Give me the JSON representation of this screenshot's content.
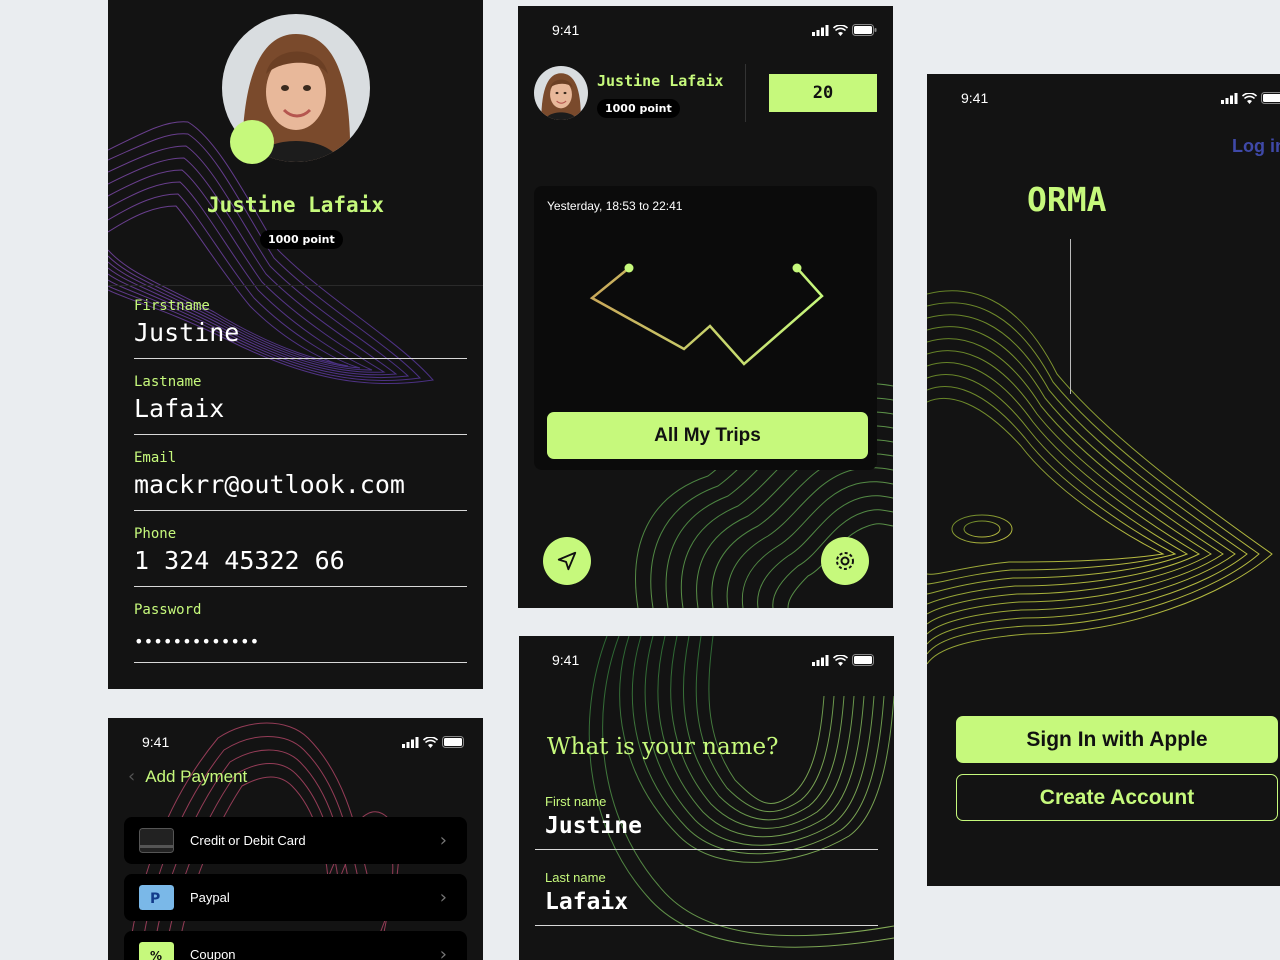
{
  "status": {
    "time": "9:41"
  },
  "profile": {
    "name": "Justine Lafaix",
    "points": "1000 point",
    "fields": [
      {
        "label": "Firstname",
        "value": "Justine"
      },
      {
        "label": "Lastname",
        "value": "Lafaix"
      },
      {
        "label": "Email",
        "value": "mackrr@outlook.com"
      },
      {
        "label": "Phone",
        "value": "1 324 45322 66"
      },
      {
        "label": "Password",
        "value": "•••••••••••••"
      }
    ]
  },
  "trips": {
    "user_name": "Justine Lafaix",
    "points": "1000 point",
    "score": "20",
    "trip_time": "Yesterday, 18:53 to 22:41",
    "all_trips_label": "All My Trips",
    "nav_icon": "navigation-arrow-icon",
    "settings_icon": "gear-icon"
  },
  "welcome": {
    "login_label": "Log in",
    "brand": "ORMA",
    "apple_label": "Sign In with Apple",
    "create_label": "Create Account"
  },
  "payment": {
    "title": "Add Payment",
    "methods": [
      {
        "label": "Credit or Debit Card",
        "icon": "card-icon"
      },
      {
        "label": "Paypal",
        "icon": "paypal-icon"
      },
      {
        "label": "Coupon",
        "icon": "coupon-icon"
      }
    ]
  },
  "name_form": {
    "question": "What is your name?",
    "fields": [
      {
        "label": "First name",
        "value": "Justine"
      },
      {
        "label": "Last name",
        "value": "Lafaix"
      }
    ]
  },
  "colors": {
    "accent": "#c6f97c",
    "bg": "#131313",
    "page": "#eaedf0",
    "link": "#3f49a8"
  }
}
